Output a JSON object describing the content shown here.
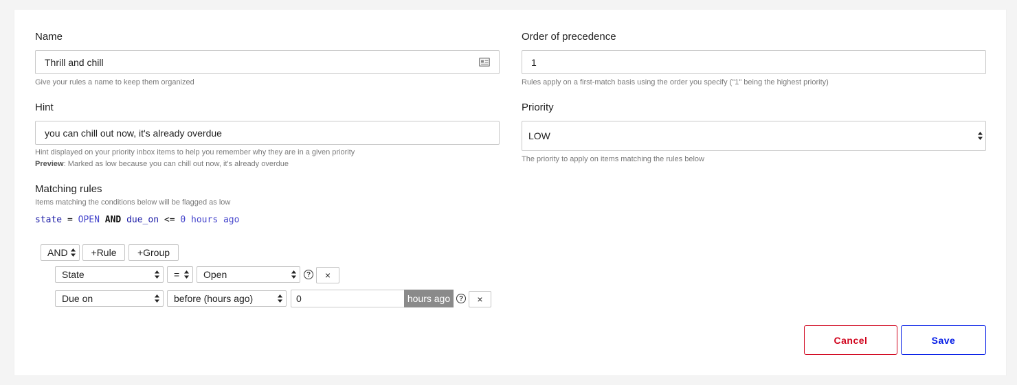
{
  "form": {
    "name": {
      "label": "Name",
      "value": "Thrill and chill",
      "help": "Give your rules a name to keep them organized",
      "icon": "id-card-icon"
    },
    "order": {
      "label": "Order of precedence",
      "value": "1",
      "help": "Rules apply on a first-match basis using the order you specify (\"1\" being the highest priority)"
    },
    "hint": {
      "label": "Hint",
      "value": "you can chill out now, it's already overdue",
      "help": "Hint displayed on your priority inbox items to help you remember why they are in a given priority",
      "preview_label": "Preview",
      "preview_text": ": Marked as low because you can chill out now, it's already overdue"
    },
    "priority": {
      "label": "Priority",
      "value": "LOW",
      "help": "The priority to apply on items matching the rules below"
    }
  },
  "matching": {
    "label": "Matching rules",
    "help": "Items matching the conditions below will be flagged as low",
    "query": {
      "t1": "state",
      "t2": " = ",
      "t3": "OPEN",
      "t4": " AND ",
      "t5": "due_on",
      "t6": " <= ",
      "t7": "0 hours ago"
    },
    "builder": {
      "combinator": "AND",
      "add_rule": "+Rule",
      "add_group": "+Group",
      "rules": [
        {
          "field": "State",
          "operator": "=",
          "value": "Open",
          "remove": "×"
        },
        {
          "field": "Due on",
          "operator": "before (hours ago)",
          "value": "0",
          "addon": "hours ago",
          "remove": "×"
        }
      ]
    }
  },
  "actions": {
    "cancel": "Cancel",
    "save": "Save"
  },
  "colors": {
    "cancel": "#d0021b",
    "save": "#0019e6",
    "keyword": "#1a1aa6",
    "value": "#4444cc"
  }
}
